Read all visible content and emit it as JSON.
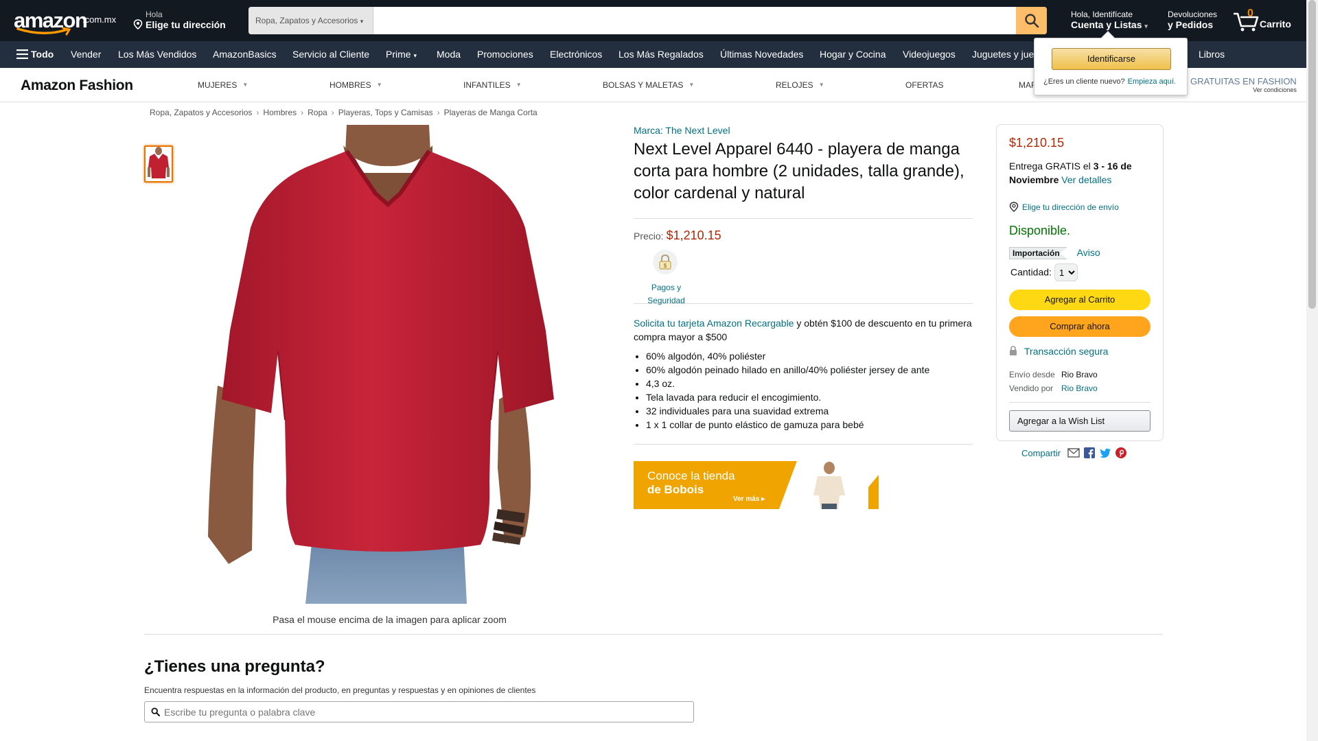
{
  "header": {
    "logo_text": "amazon",
    "logo_domain": ".com.mx",
    "address_greeting": "Hola",
    "address_prompt": "Elige tu dirección",
    "search_category": "Ropa, Zapatos y Accesorios",
    "search_value": "",
    "account_greeting": "Hola, Identifícate",
    "account_label": "Cuenta y Listas",
    "returns_line1": "Devoluciones",
    "returns_line2": "y Pedidos",
    "cart_count": "0",
    "cart_label": "Carrito",
    "accent_color": "#febd69"
  },
  "nav": {
    "all_label": "Todo",
    "items": [
      "Vender",
      "Los Más Vendidos",
      "AmazonBasics",
      "Servicio al Cliente",
      "Prime",
      "Moda",
      "Promociones",
      "Electrónicos",
      "Los Más Regalados",
      "Últimas Novedades",
      "Hogar y Cocina",
      "Videojuegos",
      "Juguetes y jue",
      "Libros"
    ]
  },
  "signin_popover": {
    "button_label": "Identificarse",
    "new_customer_text": "¿Eres un cliente nuevo?",
    "new_customer_link": "Empieza aquí."
  },
  "fashion": {
    "brand": "Amazon Fashion",
    "categories": [
      "MUJERES",
      "HOMBRES",
      "INFANTILES",
      "BOLSAS Y MALETAS",
      "RELOJES",
      "OFERTAS",
      "MAR"
    ],
    "promo_text": "GRATUITAS EN FASHION",
    "promo_sub": "Ver condiciones"
  },
  "breadcrumb": [
    "Ropa, Zapatos y Accesorios",
    "Hombres",
    "Ropa",
    "Playeras, Tops y Camisas",
    "Playeras de Manga Corta"
  ],
  "gallery": {
    "zoom_hint": "Pasa el mouse encima de la imagen para aplicar zoom",
    "shirt_color": "#c0202f"
  },
  "product": {
    "brand_line": "Marca: The Next Level",
    "title": "Next Level Apparel 6440 - playera de manga corta para hombre (2 unidades, talla grande), color cardenal y natural",
    "price_label": "Precio:",
    "price": "$1,210.15",
    "payment_label_1": "Pagos y",
    "payment_label_2": "Seguridad",
    "promo_link": "Solicita tu tarjeta Amazon Recargable",
    "promo_text": " y obtén $100 de descuento en tu primera compra mayor a $500",
    "bullets": [
      "60% algodón, 40% poliéster",
      "60% algodón peinado hilado en anillo/40% poliéster jersey de ante",
      "4,3 oz.",
      "Tela lavada para reducir el encogimiento.",
      "32 individuales para una suavidad extrema",
      "1 x 1 collar de punto elástico de gamuza para bebé"
    ],
    "banner_line1": "Conoce la tienda",
    "banner_line2": "de Bobois",
    "banner_cta": "Ver más ▸"
  },
  "buybox": {
    "price": "$1,210.15",
    "delivery_prefix": "Entrega GRATIS el ",
    "delivery_dates": "3 - 16 de Noviembre",
    "delivery_link": "Ver detalles",
    "address_link": "Elige tu dirección de envío",
    "availability": "Disponible.",
    "import_tag": "Importación",
    "import_link": "Aviso",
    "qty_label": "Cantidad:",
    "qty_value": "1",
    "add_to_cart": "Agregar al Carrito",
    "buy_now": "Comprar ahora",
    "secure": "Transacción segura",
    "ships_from_label": "Envío desde",
    "ships_from": "Rio Bravo",
    "sold_by_label": "Vendido por",
    "sold_by": "Rio Bravo",
    "wishlist": "Agregar a la Wish List",
    "share_label": "Compartir"
  },
  "questions": {
    "title": "¿Tienes una pregunta?",
    "subtitle": "Encuentra respuestas en la información del producto, en preguntas y respuestas y en opiniones de clientes",
    "placeholder": "Escribe tu pregunta o palabra clave"
  }
}
